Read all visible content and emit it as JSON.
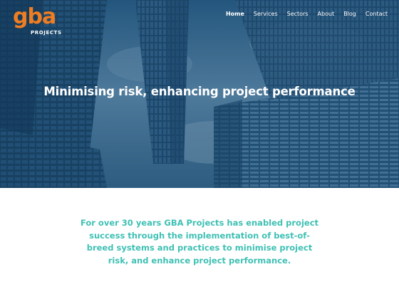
{
  "logo": {
    "mark": "gba",
    "sub": "PROJECTS"
  },
  "nav": {
    "items": [
      {
        "label": "Home",
        "active": true
      },
      {
        "label": "Services",
        "active": false
      },
      {
        "label": "Sectors",
        "active": false
      },
      {
        "label": "About",
        "active": false
      },
      {
        "label": "Blog",
        "active": false
      },
      {
        "label": "Contact",
        "active": false
      }
    ]
  },
  "hero": {
    "title": "Minimising risk, enhancing project performance"
  },
  "intro": {
    "text": "For over 30 years GBA Projects has enabled project success through the implementation of best-of-breed systems and practices to minimise project risk, and enhance project performance."
  },
  "colors": {
    "brand_orange": "#ef7d22",
    "accent_teal": "#3fc0b4",
    "hero_blue": "#1d4a6e"
  }
}
